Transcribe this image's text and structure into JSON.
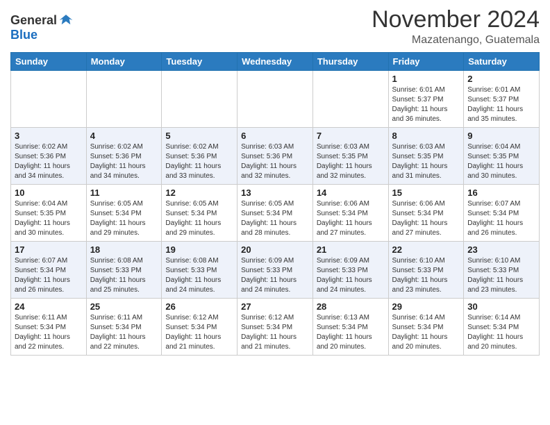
{
  "logo": {
    "general": "General",
    "blue": "Blue"
  },
  "header": {
    "month": "November 2024",
    "location": "Mazatenango, Guatemala"
  },
  "weekdays": [
    "Sunday",
    "Monday",
    "Tuesday",
    "Wednesday",
    "Thursday",
    "Friday",
    "Saturday"
  ],
  "weeks": [
    [
      {
        "day": "",
        "info": ""
      },
      {
        "day": "",
        "info": ""
      },
      {
        "day": "",
        "info": ""
      },
      {
        "day": "",
        "info": ""
      },
      {
        "day": "",
        "info": ""
      },
      {
        "day": "1",
        "info": "Sunrise: 6:01 AM\nSunset: 5:37 PM\nDaylight: 11 hours\nand 36 minutes."
      },
      {
        "day": "2",
        "info": "Sunrise: 6:01 AM\nSunset: 5:37 PM\nDaylight: 11 hours\nand 35 minutes."
      }
    ],
    [
      {
        "day": "3",
        "info": "Sunrise: 6:02 AM\nSunset: 5:36 PM\nDaylight: 11 hours\nand 34 minutes."
      },
      {
        "day": "4",
        "info": "Sunrise: 6:02 AM\nSunset: 5:36 PM\nDaylight: 11 hours\nand 34 minutes."
      },
      {
        "day": "5",
        "info": "Sunrise: 6:02 AM\nSunset: 5:36 PM\nDaylight: 11 hours\nand 33 minutes."
      },
      {
        "day": "6",
        "info": "Sunrise: 6:03 AM\nSunset: 5:36 PM\nDaylight: 11 hours\nand 32 minutes."
      },
      {
        "day": "7",
        "info": "Sunrise: 6:03 AM\nSunset: 5:35 PM\nDaylight: 11 hours\nand 32 minutes."
      },
      {
        "day": "8",
        "info": "Sunrise: 6:03 AM\nSunset: 5:35 PM\nDaylight: 11 hours\nand 31 minutes."
      },
      {
        "day": "9",
        "info": "Sunrise: 6:04 AM\nSunset: 5:35 PM\nDaylight: 11 hours\nand 30 minutes."
      }
    ],
    [
      {
        "day": "10",
        "info": "Sunrise: 6:04 AM\nSunset: 5:35 PM\nDaylight: 11 hours\nand 30 minutes."
      },
      {
        "day": "11",
        "info": "Sunrise: 6:05 AM\nSunset: 5:34 PM\nDaylight: 11 hours\nand 29 minutes."
      },
      {
        "day": "12",
        "info": "Sunrise: 6:05 AM\nSunset: 5:34 PM\nDaylight: 11 hours\nand 29 minutes."
      },
      {
        "day": "13",
        "info": "Sunrise: 6:05 AM\nSunset: 5:34 PM\nDaylight: 11 hours\nand 28 minutes."
      },
      {
        "day": "14",
        "info": "Sunrise: 6:06 AM\nSunset: 5:34 PM\nDaylight: 11 hours\nand 27 minutes."
      },
      {
        "day": "15",
        "info": "Sunrise: 6:06 AM\nSunset: 5:34 PM\nDaylight: 11 hours\nand 27 minutes."
      },
      {
        "day": "16",
        "info": "Sunrise: 6:07 AM\nSunset: 5:34 PM\nDaylight: 11 hours\nand 26 minutes."
      }
    ],
    [
      {
        "day": "17",
        "info": "Sunrise: 6:07 AM\nSunset: 5:34 PM\nDaylight: 11 hours\nand 26 minutes."
      },
      {
        "day": "18",
        "info": "Sunrise: 6:08 AM\nSunset: 5:33 PM\nDaylight: 11 hours\nand 25 minutes."
      },
      {
        "day": "19",
        "info": "Sunrise: 6:08 AM\nSunset: 5:33 PM\nDaylight: 11 hours\nand 24 minutes."
      },
      {
        "day": "20",
        "info": "Sunrise: 6:09 AM\nSunset: 5:33 PM\nDaylight: 11 hours\nand 24 minutes."
      },
      {
        "day": "21",
        "info": "Sunrise: 6:09 AM\nSunset: 5:33 PM\nDaylight: 11 hours\nand 24 minutes."
      },
      {
        "day": "22",
        "info": "Sunrise: 6:10 AM\nSunset: 5:33 PM\nDaylight: 11 hours\nand 23 minutes."
      },
      {
        "day": "23",
        "info": "Sunrise: 6:10 AM\nSunset: 5:33 PM\nDaylight: 11 hours\nand 23 minutes."
      }
    ],
    [
      {
        "day": "24",
        "info": "Sunrise: 6:11 AM\nSunset: 5:34 PM\nDaylight: 11 hours\nand 22 minutes."
      },
      {
        "day": "25",
        "info": "Sunrise: 6:11 AM\nSunset: 5:34 PM\nDaylight: 11 hours\nand 22 minutes."
      },
      {
        "day": "26",
        "info": "Sunrise: 6:12 AM\nSunset: 5:34 PM\nDaylight: 11 hours\nand 21 minutes."
      },
      {
        "day": "27",
        "info": "Sunrise: 6:12 AM\nSunset: 5:34 PM\nDaylight: 11 hours\nand 21 minutes."
      },
      {
        "day": "28",
        "info": "Sunrise: 6:13 AM\nSunset: 5:34 PM\nDaylight: 11 hours\nand 20 minutes."
      },
      {
        "day": "29",
        "info": "Sunrise: 6:14 AM\nSunset: 5:34 PM\nDaylight: 11 hours\nand 20 minutes."
      },
      {
        "day": "30",
        "info": "Sunrise: 6:14 AM\nSunset: 5:34 PM\nDaylight: 11 hours\nand 20 minutes."
      }
    ]
  ]
}
